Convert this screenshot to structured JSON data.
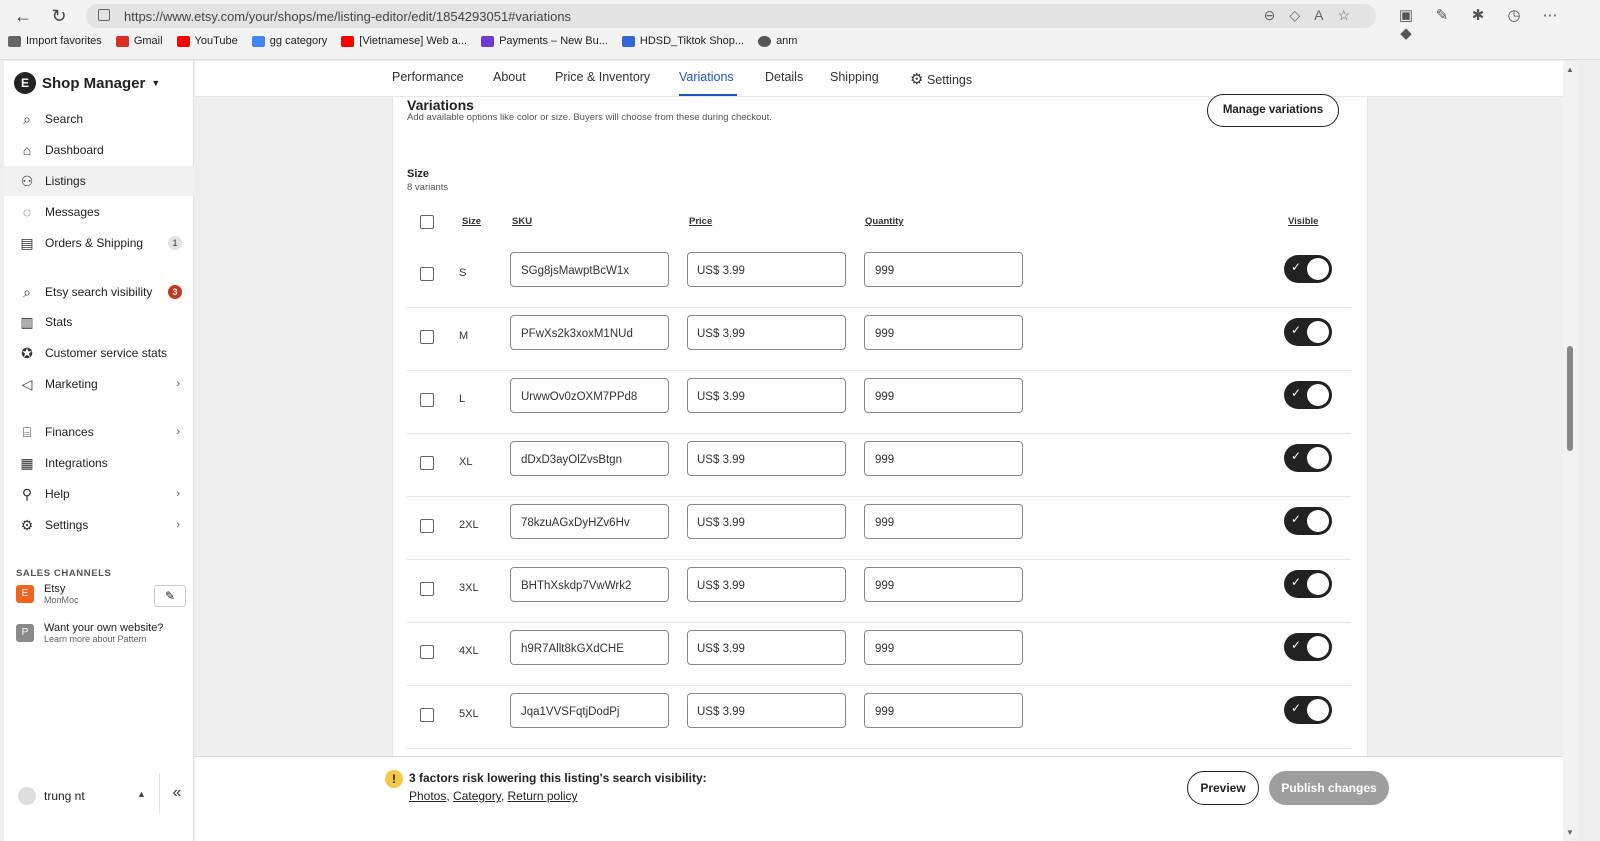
{
  "browser": {
    "url": "https://www.etsy.com/your/shops/me/listing-editor/edit/1854293051#variations",
    "bookmarks": [
      {
        "label": "Import favorites",
        "color": "#666666"
      },
      {
        "label": "Gmail",
        "color": "#d93025"
      },
      {
        "label": "YouTube",
        "color": "#ff0000"
      },
      {
        "label": "gg category",
        "color": "#4285f4"
      },
      {
        "label": "[Vietnamese] Web a...",
        "color": "#ff0000"
      },
      {
        "label": "Payments – New Bu...",
        "color": "#6e3bd1"
      },
      {
        "label": "HDSD_Tiktok Shop...",
        "color": "#3367d6"
      },
      {
        "label": "anm",
        "color": "#555555"
      }
    ]
  },
  "sidebar": {
    "title": "Shop Manager",
    "items": [
      {
        "label": "Search",
        "icon": "search-icon"
      },
      {
        "label": "Dashboard",
        "icon": "home-icon"
      },
      {
        "label": "Listings",
        "icon": "listings-icon"
      },
      {
        "label": "Messages",
        "icon": "messages-icon"
      },
      {
        "label": "Orders & Shipping",
        "icon": "orders-icon",
        "badge": "1"
      },
      {
        "label": "Etsy search visibility",
        "icon": "search-visibility-icon",
        "badge": "3"
      },
      {
        "label": "Stats",
        "icon": "stats-icon"
      },
      {
        "label": "Customer service stats",
        "icon": "star-icon"
      },
      {
        "label": "Marketing",
        "icon": "megaphone-icon"
      },
      {
        "label": "Finances",
        "icon": "bank-icon"
      },
      {
        "label": "Integrations",
        "icon": "grid-icon"
      },
      {
        "label": "Help",
        "icon": "help-icon"
      },
      {
        "label": "Settings",
        "icon": "gear-icon"
      }
    ],
    "sales_channels_title": "SALES CHANNELS",
    "channel_etsy": {
      "name": "Etsy",
      "shop": "MonMoc",
      "icon_letter": "E"
    },
    "channel_pattern": {
      "name": "Want your own website?",
      "sub": "Learn more about Pattern",
      "icon_letter": "P"
    },
    "user": "trung nt"
  },
  "tabs": [
    "Performance",
    "About",
    "Price & Inventory",
    "Variations",
    "Details",
    "Shipping",
    "Settings"
  ],
  "active_tab": "Variations",
  "variations": {
    "title": "Variations",
    "subtitle": "Add available options like color or size. Buyers will choose from these during checkout.",
    "manage_button": "Manage variations",
    "group_title": "Size",
    "group_sub": "8 variants",
    "columns": {
      "size": "Size",
      "sku": "SKU",
      "price": "Price",
      "quantity": "Quantity",
      "visible": "Visible"
    },
    "rows": [
      {
        "size": "S",
        "sku": "SGg8jsMawptBcW1x",
        "price": "US$ 3.99",
        "qty": "999"
      },
      {
        "size": "M",
        "sku": "PFwXs2k3xoxM1NUd",
        "price": "US$ 3.99",
        "qty": "999"
      },
      {
        "size": "L",
        "sku": "UrwwOv0zOXM7PPd8",
        "price": "US$ 3.99",
        "qty": "999"
      },
      {
        "size": "XL",
        "sku": "dDxD3ayOlZvsBtgn",
        "price": "US$ 3.99",
        "qty": "999"
      },
      {
        "size": "2XL",
        "sku": "78kzuAGxDyHZv6Hv",
        "price": "US$ 3.99",
        "qty": "999"
      },
      {
        "size": "3XL",
        "sku": "BHThXskdp7VwWrk2",
        "price": "US$ 3.99",
        "qty": "999"
      },
      {
        "size": "4XL",
        "sku": "h9R7Allt8kGXdCHE",
        "price": "US$ 3.99",
        "qty": "999"
      },
      {
        "size": "5XL",
        "sku": "Jqa1VVSFqtjDodPj",
        "price": "US$ 3.99",
        "qty": "999"
      }
    ]
  },
  "footer": {
    "warning": "3 factors risk lowering this listing's search visibility:",
    "links": [
      "Photos",
      "Category",
      "Return policy"
    ],
    "preview": "Preview",
    "publish": "Publish changes"
  }
}
